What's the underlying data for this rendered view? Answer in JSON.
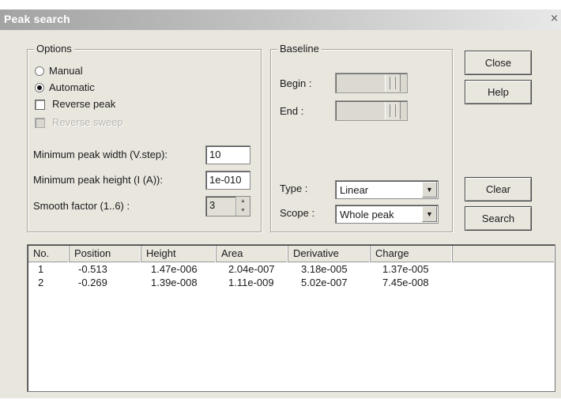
{
  "window": {
    "title": "Peak search",
    "close_glyph": "×"
  },
  "options": {
    "group_label": "Options",
    "manual_label": "Manual",
    "manual_checked": false,
    "automatic_label": "Automatic",
    "automatic_checked": true,
    "reverse_peak_label": "Reverse peak",
    "reverse_peak_checked": false,
    "reverse_sweep_label": "Reverse sweep",
    "reverse_sweep_enabled": false,
    "min_width_label": "Minimum peak width (V.step):",
    "min_width_value": "10",
    "min_height_label": "Minimum peak height (I (A)):",
    "min_height_value": "1e-010",
    "smooth_label": "Smooth factor (1..6) :",
    "smooth_value": "3"
  },
  "baseline": {
    "group_label": "Baseline",
    "begin_label": "Begin :",
    "end_label": "End :",
    "type_label": "Type :",
    "type_value": "Linear",
    "scope_label": "Scope :",
    "scope_value": "Whole peak"
  },
  "buttons": {
    "close": "Close",
    "help": "Help",
    "clear": "Clear",
    "search": "Search"
  },
  "results": {
    "columns": [
      "No.",
      "Position",
      "Height",
      "Area",
      "Derivative",
      "Charge"
    ],
    "rows": [
      [
        "1",
        "-0.513",
        "1.47e-006",
        "2.04e-007",
        "3.18e-005",
        "1.37e-005"
      ],
      [
        "2",
        "-0.269",
        "1.39e-008",
        "1.11e-009",
        "5.02e-007",
        "7.45e-008"
      ]
    ]
  }
}
